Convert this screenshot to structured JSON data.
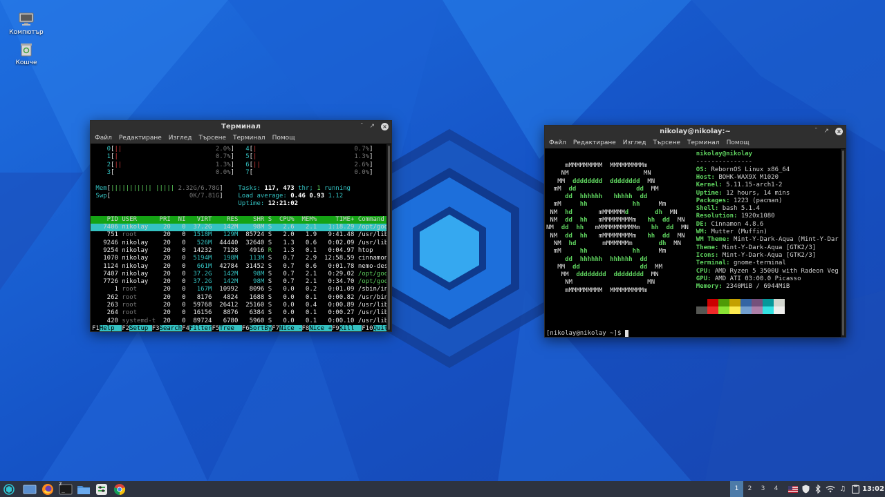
{
  "desktop": {
    "icons": [
      {
        "label": "Компютър"
      },
      {
        "label": "Кошче"
      }
    ]
  },
  "colors": {
    "panel": "#2d3340",
    "workspace_active": "#4d7ba8",
    "htop_cyan": "#34c2c2",
    "htop_green": "#15a315",
    "neofetch_green": "#5fd35f"
  },
  "htop_window": {
    "title": "Терминал",
    "menu": [
      "Файл",
      "Редактиране",
      "Изглед",
      "Търсене",
      "Терминал",
      "Помощ"
    ],
    "cpus": [
      {
        "id": "0",
        "bar": "||",
        "pct": "2.0%"
      },
      {
        "id": "1",
        "bar": "|",
        "pct": "0.7%"
      },
      {
        "id": "2",
        "bar": "||",
        "pct": "1.3%"
      },
      {
        "id": "3",
        "bar": "",
        "pct": "0.0%"
      },
      {
        "id": "4",
        "bar": "|",
        "pct": "0.7%"
      },
      {
        "id": "5",
        "bar": "|",
        "pct": "1.3%"
      },
      {
        "id": "6",
        "bar": "||",
        "pct": "2.6%"
      },
      {
        "id": "7",
        "bar": "",
        "pct": "0.0%"
      }
    ],
    "mem": {
      "label": "Mem",
      "bar": "||||||||||| |||||",
      "value": "2.32G/6.78G"
    },
    "swp": {
      "label": "Swp",
      "bar": "",
      "value": "0K/7.81G"
    },
    "tasks": {
      "label": "Tasks:",
      "count": "117",
      "thr": "473",
      "thr_label": "thr;",
      "running": "1",
      "running_label": "running"
    },
    "load": {
      "label": "Load average:",
      "v1": "0.46",
      "v2": "0.93",
      "v3": "1.12"
    },
    "uptime": {
      "label": "Uptime:",
      "value": "12:21:02"
    },
    "columns": [
      "PID",
      "USER",
      "PRI",
      "NI",
      "VIRT",
      "RES",
      "SHR",
      "S",
      "CPU%",
      "MEM%",
      "TIME+",
      "Command"
    ],
    "processes": [
      {
        "pid": "7406",
        "user": "nikolay",
        "pri": "20",
        "ni": "0",
        "virt": "37.2G",
        "res": "142M",
        "shr": "98M",
        "s": "S",
        "cpu": "2.6",
        "mem": "2.1",
        "time": "1:18.29",
        "cmd": "/opt/google/chr"
      },
      {
        "pid": "751",
        "user": "root",
        "pri": "20",
        "ni": "0",
        "virt": "1518M",
        "res": "129M",
        "shr": "85724",
        "s": "S",
        "cpu": "2.0",
        "mem": "1.9",
        "time": "9:41.48",
        "cmd": "/usr/lib/Xorg :"
      },
      {
        "pid": "9246",
        "user": "nikolay",
        "pri": "20",
        "ni": "0",
        "virt": "526M",
        "res": "44440",
        "shr": "32640",
        "s": "S",
        "cpu": "1.3",
        "mem": "0.6",
        "time": "0:02.09",
        "cmd": "/usr/lib/gnome-"
      },
      {
        "pid": "9254",
        "user": "nikolay",
        "pri": "20",
        "ni": "0",
        "virt": "14232",
        "res": "7128",
        "shr": "4916",
        "s": "R",
        "cpu": "1.3",
        "mem": "0.1",
        "time": "0:04.97",
        "cmd": "htop"
      },
      {
        "pid": "1070",
        "user": "nikolay",
        "pri": "20",
        "ni": "0",
        "virt": "5194M",
        "res": "198M",
        "shr": "113M",
        "s": "S",
        "cpu": "0.7",
        "mem": "2.9",
        "time": "12:58.59",
        "cmd": "cinnamon --repl"
      },
      {
        "pid": "1124",
        "user": "nikolay",
        "pri": "20",
        "ni": "0",
        "virt": "661M",
        "res": "42784",
        "shr": "31452",
        "s": "S",
        "cpu": "0.7",
        "mem": "0.6",
        "time": "0:01.78",
        "cmd": "nemo-desktop"
      },
      {
        "pid": "7407",
        "user": "nikolay",
        "pri": "20",
        "ni": "0",
        "virt": "37.2G",
        "res": "142M",
        "shr": "98M",
        "s": "S",
        "cpu": "0.7",
        "mem": "2.1",
        "time": "0:29.02",
        "cmd": "/opt/google/chr"
      },
      {
        "pid": "7726",
        "user": "nikolay",
        "pri": "20",
        "ni": "0",
        "virt": "37.2G",
        "res": "142M",
        "shr": "98M",
        "s": "S",
        "cpu": "0.7",
        "mem": "2.1",
        "time": "0:34.70",
        "cmd": "/opt/google/chr"
      },
      {
        "pid": "1",
        "user": "root",
        "pri": "20",
        "ni": "0",
        "virt": "167M",
        "res": "10992",
        "shr": "8096",
        "s": "S",
        "cpu": "0.0",
        "mem": "0.2",
        "time": "0:01.09",
        "cmd": "/sbin/init"
      },
      {
        "pid": "262",
        "user": "root",
        "pri": "20",
        "ni": "0",
        "virt": "8176",
        "res": "4824",
        "shr": "1688",
        "s": "S",
        "cpu": "0.0",
        "mem": "0.1",
        "time": "0:00.82",
        "cmd": "/usr/bin/havege"
      },
      {
        "pid": "263",
        "user": "root",
        "pri": "20",
        "ni": "0",
        "virt": "59768",
        "res": "26412",
        "shr": "25160",
        "s": "S",
        "cpu": "0.0",
        "mem": "0.4",
        "time": "0:00.89",
        "cmd": "/usr/lib/system"
      },
      {
        "pid": "264",
        "user": "root",
        "pri": "20",
        "ni": "0",
        "virt": "16156",
        "res": "8876",
        "shr": "6384",
        "s": "S",
        "cpu": "0.0",
        "mem": "0.1",
        "time": "0:00.27",
        "cmd": "/usr/lib/system"
      },
      {
        "pid": "420",
        "user": "systemd-t",
        "pri": "20",
        "ni": "0",
        "virt": "89724",
        "res": "6780",
        "shr": "5960",
        "s": "S",
        "cpu": "0.0",
        "mem": "0.1",
        "time": "0:00.10",
        "cmd": "/usr/lib/system"
      }
    ],
    "fkeys": [
      {
        "key": "F1",
        "label": "Help"
      },
      {
        "key": "F2",
        "label": "Setup"
      },
      {
        "key": "F3",
        "label": "Search"
      },
      {
        "key": "F4",
        "label": "Filter"
      },
      {
        "key": "F5",
        "label": "Tree"
      },
      {
        "key": "F6",
        "label": "SortBy"
      },
      {
        "key": "F7",
        "label": "Nice -"
      },
      {
        "key": "F8",
        "label": "Nice +"
      },
      {
        "key": "F9",
        "label": "Kill"
      },
      {
        "key": "F10",
        "label": "Quit"
      }
    ]
  },
  "neofetch_window": {
    "title": "nikolay@nikolay:~",
    "menu": [
      "Файл",
      "Редактиране",
      "Изглед",
      "Търсене",
      "Терминал",
      "Помощ"
    ],
    "header": "nikolay@nikolay",
    "separator": "---------------",
    "logo_lines": [
      "     mMMMMMMMMM  MMMMMMMMMm",
      "    NM                    MN",
      "   MM  dddddddd  dddddddd  MN",
      "  mM  dd                dd  MM",
      "     dd  hhhhhh   hhhhh  dd",
      "  mM     hh            hh     Mm",
      " NM  hd       mMMMMMMd       dh  MN",
      " NM  dd  hh   mMMMMMMMMm   hh  dd  MN",
      "NM  dd  hh   mMMMMMMMMMMm   hh  dd  MN",
      " NM  dd  hh   mMMMMMMMMm   hh  dd  MN",
      "  NM  hd       mMMMMMMm       dh  MN",
      "  mM     hh            hh     Mm",
      "     dd  hhhhhh  hhhhhh  dd",
      "   MM  dd                dd  MM",
      "    MM  dddddddd  dddddddd  MN",
      "     NM                    MN",
      "     mMMMMMMMMM  MMMMMMMMMm"
    ],
    "info": [
      {
        "label": "OS:",
        "value": "RebornOS Linux x86_64"
      },
      {
        "label": "Host:",
        "value": "BOHK-WAX9X M1020"
      },
      {
        "label": "Kernel:",
        "value": "5.11.15-arch1-2"
      },
      {
        "label": "Uptime:",
        "value": "12 hours, 14 mins"
      },
      {
        "label": "Packages:",
        "value": "1223 (pacman)"
      },
      {
        "label": "Shell:",
        "value": "bash 5.1.4"
      },
      {
        "label": "Resolution:",
        "value": "1920x1080"
      },
      {
        "label": "DE:",
        "value": "Cinnamon 4.8.6"
      },
      {
        "label": "WM:",
        "value": "Mutter (Muffin)"
      },
      {
        "label": "WM Theme:",
        "value": "Mint-Y-Dark-Aqua (Mint-Y-Dar"
      },
      {
        "label": "Theme:",
        "value": "Mint-Y-Dark-Aqua [GTK2/3]"
      },
      {
        "label": "Icons:",
        "value": "Mint-Y-Dark-Aqua [GTK2/3]"
      },
      {
        "label": "Terminal:",
        "value": "gnome-terminal"
      },
      {
        "label": "CPU:",
        "value": "AMD Ryzen 5 3500U with Radeon Veg"
      },
      {
        "label": "GPU:",
        "value": "AMD ATI 03:00.0 Picasso"
      },
      {
        "label": "Memory:",
        "value": "2340MiB / 6944MiB"
      }
    ],
    "palette_dark": [
      "#000000",
      "#cc0000",
      "#4e9a06",
      "#c4a000",
      "#3465a4",
      "#75507b",
      "#06989a",
      "#d3d7cf"
    ],
    "palette_bright": [
      "#555753",
      "#ef2929",
      "#8ae234",
      "#fce94f",
      "#729fcf",
      "#ad7fa8",
      "#34e2e2",
      "#eeeeec"
    ],
    "prompt": "[nikolay@nikolay ~]$"
  },
  "taskbar": {
    "workspaces": [
      "1",
      "2",
      "3",
      "4"
    ],
    "terminal_badge": "2",
    "clock": "13:02",
    "launchers": [
      "menu-icon",
      "show-desktop-icon",
      "firefox-icon",
      "terminal-icon",
      "files-icon",
      "settings-icon",
      "chrome-icon"
    ]
  }
}
